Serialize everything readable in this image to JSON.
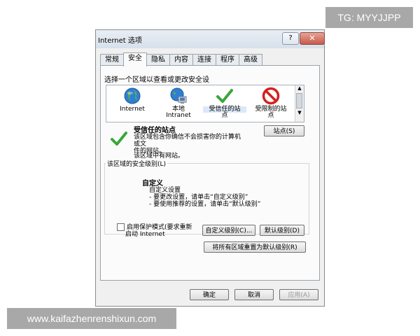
{
  "watermarks": {
    "top_right": "TG: MYYJJPP",
    "bottom_left": "www.kaifazhenrenshixun.com"
  },
  "window": {
    "title": "Internet 选项",
    "help_label": "?",
    "close_label": "✕"
  },
  "tabs": [
    "常规",
    "安全",
    "隐私",
    "内容",
    "连接",
    "程序",
    "高级"
  ],
  "active_tab": "安全",
  "zones_section": {
    "label": "选择一个区域以查看或更改安全设",
    "zones": [
      {
        "name": "internet",
        "label": "Internet",
        "label2": "",
        "icon": "globe-icon"
      },
      {
        "name": "local-intranet",
        "label": "本地",
        "label2": "Intranet",
        "icon": "intranet-icon"
      },
      {
        "name": "trusted-sites",
        "label": "受信任的站",
        "label2": "点",
        "icon": "check-icon"
      },
      {
        "name": "restricted-sites",
        "label": "受限制的站",
        "label2": "点",
        "icon": "no-entry-icon"
      }
    ]
  },
  "selected_zone": {
    "title": "受信任的站点",
    "desc_line1": "该区域包含你确信不会损害你的计算机或文",
    "desc_line2": "件的网站。",
    "note": "该区域中有网站。",
    "sites_button": "站点(S)"
  },
  "security_level": {
    "group_label": "该区域的安全级别(L)",
    "custom_title": "自定义",
    "lines": [
      "自定义设置",
      "- 要更改设置，请单击“自定义级别”",
      "- 要使用推荐的设置，请单击“默认级别”"
    ],
    "protected_mode_line1": "启用保护模式(要求重新",
    "protected_mode_line2": "启动 Internet",
    "custom_level_button": "自定义级别(C)...",
    "default_level_button": "默认级别(D)",
    "reset_all_button": "将所有区域重置为默认级别(R)"
  },
  "footer": {
    "ok": "确定",
    "cancel": "取消",
    "apply": "应用(A)"
  }
}
